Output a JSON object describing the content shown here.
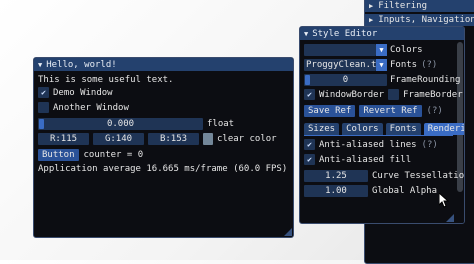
{
  "bg_window": {
    "items": [
      "Filtering",
      "Inputs, Navigation &"
    ]
  },
  "hello": {
    "title": "Hello, world!",
    "text": "This is some useful text.",
    "demo_window": "Demo Window",
    "another_window": "Another Window",
    "float_value": "0.000",
    "float_label": "float",
    "r": "R:115",
    "g": "G:140",
    "b": "B:153",
    "clear_color": "clear color",
    "button": "Button",
    "counter": "counter = 0",
    "app_avg": "Application average 16.665 ms/frame (60.0 FPS)"
  },
  "style": {
    "title": "Style Editor",
    "colors_label": "Colors",
    "font_value": "ProggyClean.tt",
    "fonts_label": "Fonts",
    "fonts_help": "(?)",
    "frame_rounding_value": "0",
    "frame_rounding_label": "FrameRounding",
    "window_border": "WindowBorder",
    "frame_border": "FrameBorder",
    "save_ref": "Save Ref",
    "revert_ref": "Revert Ref",
    "ref_help": "(?)",
    "tabs": [
      "Sizes",
      "Colors",
      "Fonts",
      "Rendering"
    ],
    "aa_lines": "Anti-aliased lines",
    "aa_lines_help": "(?)",
    "aa_fill": "Anti-aliased fill",
    "curve_value": "1.25",
    "curve_label": "Curve Tessellation",
    "alpha_value": "1.00",
    "alpha_label": "Global Alpha"
  },
  "colors": {
    "window_bg": "#0c0d12",
    "title_bg": "#24416e",
    "frame_bg": "#1f3455",
    "button": "#2a5298",
    "accent": "#3a6cc4",
    "swatch": "#738799"
  }
}
